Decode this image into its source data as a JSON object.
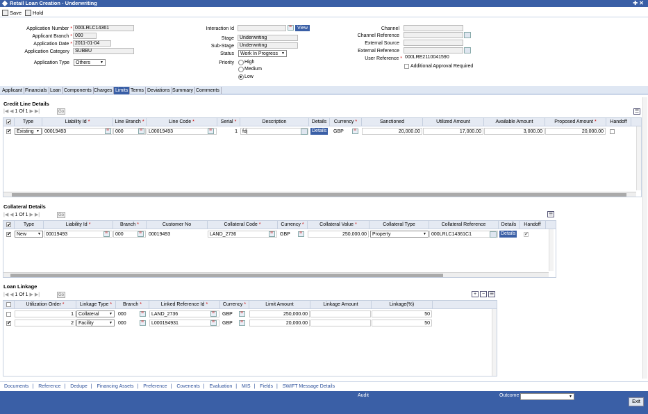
{
  "window": {
    "title": "Retail Loan Creation - Underwriting",
    "controls": "✚ ✕"
  },
  "toolbar": {
    "save": "Save",
    "hold": "Hold"
  },
  "header": {
    "app_number_label": "Application Number",
    "app_number": "000LRLC14361",
    "branch_label": "Applicant Branch",
    "branch": "000",
    "date_label": "Application Date",
    "date": "2011-01-04",
    "category_label": "Application Category",
    "category": "SUBBU",
    "type_label": "Application Type",
    "type": "Others",
    "interaction_label": "Interaction Id",
    "interaction": "",
    "view": "View",
    "stage_label": "Stage",
    "stage": "Underwriting",
    "substage_label": "Sub-Stage",
    "substage": "Underwriting",
    "status_label": "Status",
    "status": "Work In Progress",
    "priority_label": "Priority",
    "priority_high": "High",
    "priority_medium": "Medium",
    "priority_low": "Low",
    "channel_label": "Channel",
    "channel": "",
    "channel_ref_label": "Channel Reference",
    "channel_ref": "",
    "ext_source_label": "External Source",
    "ext_source": "",
    "ext_ref_label": "External Reference",
    "ext_ref": "",
    "user_ref_label": "User Reference",
    "user_ref": "000LRE2110041590",
    "additional_approval": "Additional Approval Required"
  },
  "tabs": [
    "Applicant",
    "Financials",
    "Loan",
    "Components",
    "Charges",
    "Limits",
    "Terms",
    "Deviations",
    "Summary",
    "Comments"
  ],
  "credit": {
    "title": "Credit Line Details",
    "pager": "1 Of 1",
    "go": "Go",
    "headers": [
      "Type",
      "Liability Id",
      "Line Branch",
      "Line Code",
      "Serial",
      "Description",
      "Details",
      "Currency",
      "Sanctioned",
      "Utilized Amount",
      "Available Amount",
      "Proposed Amount",
      "Handoff"
    ],
    "row": {
      "type": "Existing",
      "liability": "00019493",
      "branch": "000",
      "line_code": "L00019493",
      "serial": "1",
      "description": "fdj",
      "details": "Details",
      "currency": "GBP",
      "sanctioned": "20,000.00",
      "utilized": "17,000.00",
      "available": "3,000.00",
      "proposed": "20,000.00"
    }
  },
  "collateral": {
    "title": "Collateral Details",
    "pager": "1 Of 1",
    "go": "Go",
    "headers": [
      "Type",
      "Liability Id",
      "Branch",
      "Customer No",
      "Collateral Code",
      "Currency",
      "Collateral Value",
      "Collateral Type",
      "Collateral Reference",
      "Details",
      "Handoff"
    ],
    "row": {
      "type": "New",
      "liability": "00019493",
      "branch": "000",
      "customer": "00019493",
      "code": "LAND_2736",
      "currency": "GBP",
      "value": "250,000.00",
      "ctype": "Property",
      "reference": "000LRLC14361C1",
      "details": "Details"
    }
  },
  "linkage": {
    "title": "Loan Linkage",
    "pager": "1 Of 1",
    "go": "Go",
    "headers": [
      "Utilization Order",
      "Linkage Type",
      "Branch",
      "Linked Reference Id",
      "Currency",
      "Limit Amount",
      "Linkage Amount",
      "Linkage(%)"
    ],
    "rows": [
      {
        "order": "1",
        "ltype": "Collateral",
        "branch": "000",
        "ref": "LAND_2736",
        "currency": "GBP",
        "limit": "250,000.00",
        "amount": "",
        "pct": "50"
      },
      {
        "order": "2",
        "ltype": "Facility",
        "branch": "000",
        "ref": "L000194931",
        "currency": "GBP",
        "limit": "20,000.00",
        "amount": "",
        "pct": "50"
      }
    ]
  },
  "bottom_links": [
    "Documents",
    "Reference",
    "Dedupe",
    "Financing Assets",
    "Preference",
    "Covenents",
    "Evaluation",
    "MIS",
    "Fields",
    "SWIFT Message Details"
  ],
  "footer": {
    "audit": "Audit",
    "outcome_label": "Outcome",
    "outcome": "",
    "exit": "Exit"
  },
  "colors": {
    "brand": "#3a5fa6",
    "tab_bg": "#dfe7f3"
  }
}
